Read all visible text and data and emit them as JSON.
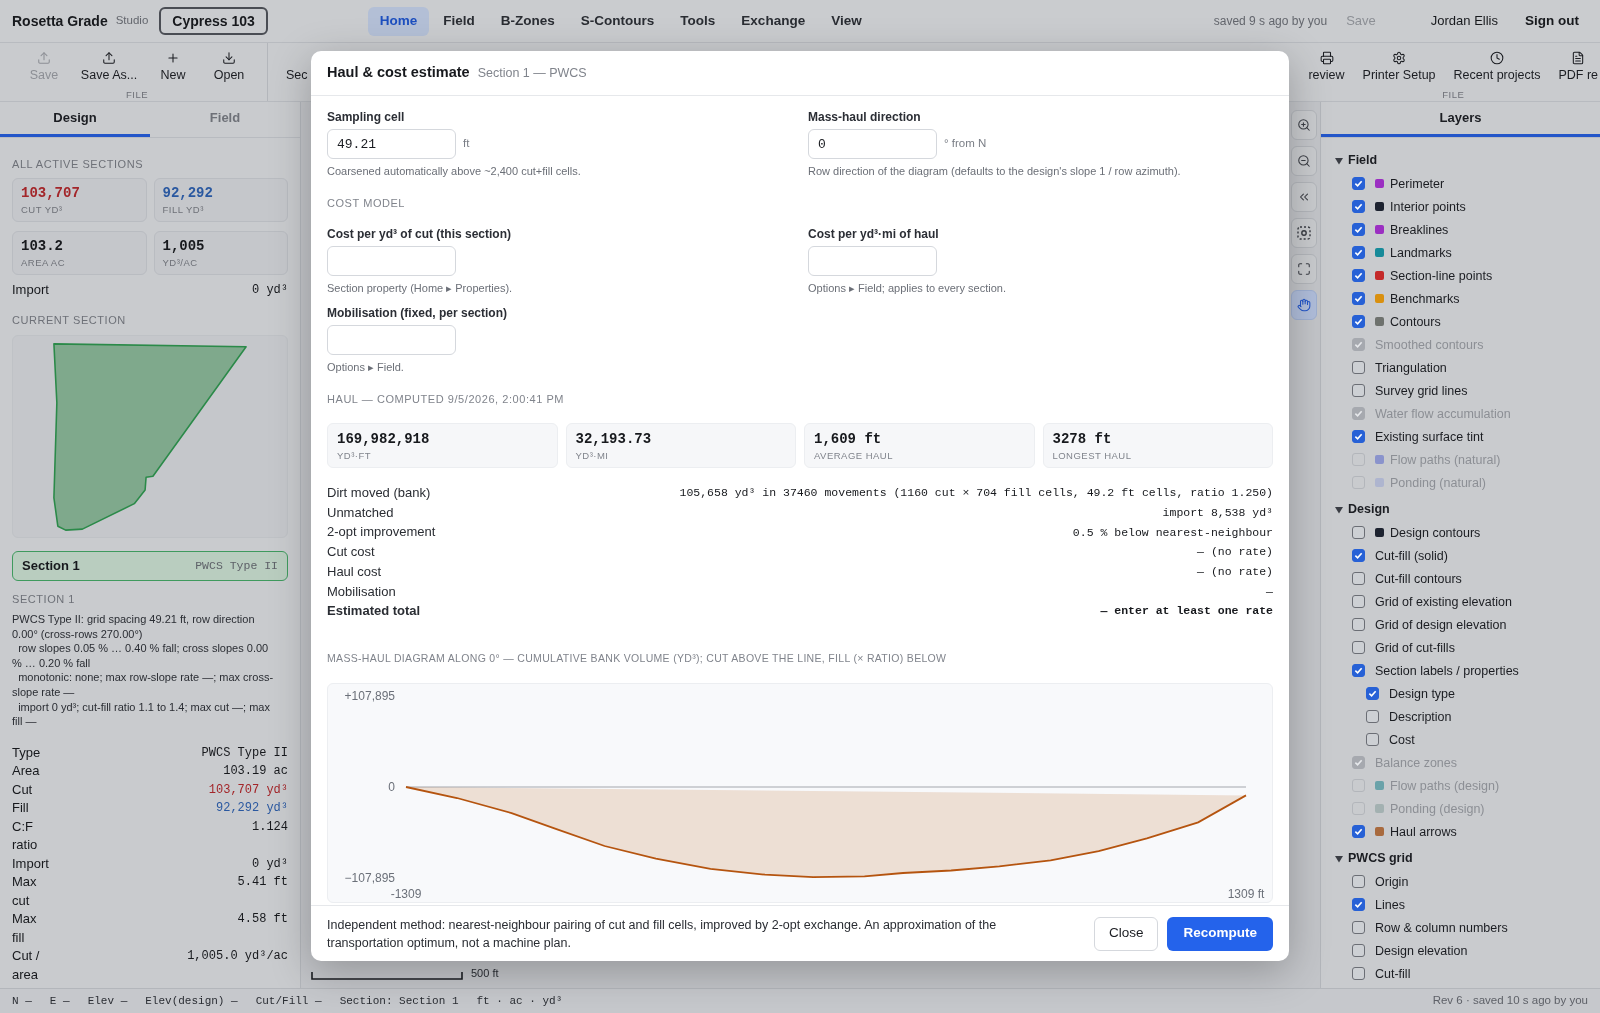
{
  "header": {
    "app_name": "Rosetta Grade",
    "edition": "Studio",
    "project": "Cypress 103",
    "nav": [
      {
        "label": "Home",
        "selected": true
      },
      {
        "label": "Field",
        "selected": false
      },
      {
        "label": "B-Zones",
        "selected": false
      },
      {
        "label": "S-Contours",
        "selected": false
      },
      {
        "label": "Tools",
        "selected": false
      },
      {
        "label": "Exchange",
        "selected": false
      },
      {
        "label": "View",
        "selected": false
      }
    ],
    "save_status": "saved 9 s ago by you",
    "save": {
      "label": "Save",
      "disabled": true
    },
    "user": "Jordan Ellis",
    "sign_out": "Sign out"
  },
  "toolbar": {
    "left_group": {
      "label": "FILE",
      "items": [
        {
          "kind": "save",
          "label": "Save",
          "disabled": true
        },
        {
          "kind": "save-as",
          "label": "Save As...",
          "disabled": false
        },
        {
          "kind": "new",
          "label": "New",
          "disabled": false
        },
        {
          "kind": "open",
          "label": "Open",
          "disabled": false
        }
      ]
    },
    "section_item": {
      "label": "Sec"
    },
    "right_group": {
      "label": "FILE",
      "items": [
        {
          "kind": "preview",
          "label": "review"
        },
        {
          "kind": "printer-setup",
          "label": "Printer Setup"
        },
        {
          "kind": "recent",
          "label": "Recent projects"
        },
        {
          "kind": "pdf",
          "label": "PDF re"
        }
      ]
    }
  },
  "left_panel": {
    "tabs": [
      {
        "label": "Design",
        "selected": true
      },
      {
        "label": "Field",
        "selected": false
      }
    ],
    "totals_heading": "ALL ACTIVE SECTIONS",
    "totals": [
      {
        "value": "103,707",
        "label": "CUT YD³",
        "kind": "cut"
      },
      {
        "value": "92,292",
        "label": "FILL YD³",
        "kind": "fill"
      },
      {
        "value": "103.2",
        "label": "AREA AC",
        "kind": "plain"
      },
      {
        "value": "1,005",
        "label": "YD³/AC",
        "kind": "plain"
      }
    ],
    "import": {
      "label": "Import",
      "value": "0 yd³"
    },
    "current_heading": "CURRENT SECTION",
    "sections": [
      {
        "name": "Section 1",
        "type": "PWCS Type II",
        "selected": true
      }
    ],
    "detail_heading": "SECTION 1",
    "description": "PWCS Type II: grid spacing 49.21 ft, row direction 0.00° (cross-rows 270.00°)\n  row slopes 0.05 % … 0.40 % fall; cross slopes 0.00 % … 0.20 % fall\n  monotonic: none; max row-slope rate —; max cross-slope rate —\n  import 0 yd³; cut-fill ratio 1.1 to 1.4; max cut —; max fill —",
    "properties": [
      {
        "label": "Type",
        "value": "PWCS Type II",
        "kind": "plain"
      },
      {
        "label": "Area",
        "value": "103.19 ac",
        "kind": "plain"
      },
      {
        "label": "Cut",
        "value": "103,707 yd³",
        "kind": "cut"
      },
      {
        "label": "Fill",
        "value": "92,292 yd³",
        "kind": "fill"
      },
      {
        "label": "C:F ratio",
        "value": "1.124",
        "kind": "plain"
      },
      {
        "label": "Import",
        "value": "0 yd³",
        "kind": "plain"
      },
      {
        "label": "Max cut",
        "value": "5.41 ft",
        "kind": "plain"
      },
      {
        "label": "Max fill",
        "value": "4.58 ft",
        "kind": "plain"
      },
      {
        "label": "Cut / area",
        "value": "1,005.0 yd³/ac",
        "kind": "plain"
      }
    ]
  },
  "canvas": {
    "tools": [
      {
        "kind": "zoom-in",
        "active": false
      },
      {
        "kind": "zoom-out",
        "active": false
      },
      {
        "kind": "collapse",
        "active": false
      },
      {
        "kind": "select",
        "active": false
      },
      {
        "kind": "fit",
        "active": false
      },
      {
        "kind": "pan",
        "active": true
      }
    ],
    "scale_label": "500 ft"
  },
  "layers": {
    "tab": {
      "label": "Layers",
      "selected": true
    },
    "groups": [
      {
        "label": "Field",
        "expanded": true,
        "items": [
          {
            "label": "Perimeter",
            "checked": true,
            "disabled": false,
            "color": "#9b2fc2"
          },
          {
            "label": "Interior points",
            "checked": true,
            "disabled": false,
            "color": "#1d2330"
          },
          {
            "label": "Breaklines",
            "checked": true,
            "disabled": false,
            "color": "#9b2fc2"
          },
          {
            "label": "Landmarks",
            "checked": true,
            "disabled": false,
            "color": "#168a99"
          },
          {
            "label": "Section-line points",
            "checked": true,
            "disabled": false,
            "color": "#c42a2a"
          },
          {
            "label": "Benchmarks",
            "checked": true,
            "disabled": false,
            "color": "#d9900f"
          },
          {
            "label": "Contours",
            "checked": true,
            "disabled": false,
            "color": "#6e726e"
          },
          {
            "label": "Smoothed contours",
            "checked": true,
            "disabled": true
          },
          {
            "label": "Triangulation",
            "checked": false,
            "disabled": false
          },
          {
            "label": "Survey grid lines",
            "checked": false,
            "disabled": false
          },
          {
            "label": "Water flow accumulation",
            "checked": true,
            "disabled": true
          },
          {
            "label": "Existing surface tint",
            "checked": true,
            "disabled": false
          },
          {
            "label": "Flow paths (natural)",
            "checked": false,
            "disabled": true,
            "color": "#8a93cc"
          },
          {
            "label": "Ponding (natural)",
            "checked": false,
            "disabled": true,
            "color": "#aeb5cf"
          }
        ]
      },
      {
        "label": "Design",
        "expanded": true,
        "items": [
          {
            "label": "Design contours",
            "checked": false,
            "disabled": false,
            "color": "#1d2330"
          },
          {
            "label": "Cut-fill (solid)",
            "checked": true,
            "disabled": false
          },
          {
            "label": "Cut-fill contours",
            "checked": false,
            "disabled": false
          },
          {
            "label": "Grid of existing elevation",
            "checked": false,
            "disabled": false
          },
          {
            "label": "Grid of design elevation",
            "checked": false,
            "disabled": false
          },
          {
            "label": "Grid of cut-fills",
            "checked": false,
            "disabled": false
          },
          {
            "label": "Section labels / properties",
            "checked": true,
            "disabled": false,
            "children": [
              {
                "label": "Design type",
                "checked": true,
                "disabled": false
              },
              {
                "label": "Description",
                "checked": false,
                "disabled": false
              },
              {
                "label": "Cost",
                "checked": false,
                "disabled": false
              }
            ]
          },
          {
            "label": "Balance zones",
            "checked": true,
            "disabled": true
          },
          {
            "label": "Flow paths (design)",
            "checked": false,
            "disabled": true,
            "color": "#6aa2a9"
          },
          {
            "label": "Ponding (design)",
            "checked": false,
            "disabled": true,
            "color": "#a3b1b1"
          },
          {
            "label": "Haul arrows",
            "checked": true,
            "disabled": false,
            "color": "#a86a3e"
          }
        ]
      },
      {
        "label": "PWCS grid",
        "expanded": true,
        "items": [
          {
            "label": "Origin",
            "checked": false,
            "disabled": false
          },
          {
            "label": "Lines",
            "checked": true,
            "disabled": false
          },
          {
            "label": "Row & column numbers",
            "checked": false,
            "disabled": false
          },
          {
            "label": "Design elevation",
            "checked": false,
            "disabled": false
          },
          {
            "label": "Cut-fill",
            "checked": false,
            "disabled": false
          }
        ]
      }
    ]
  },
  "status_bar": {
    "readouts": [
      "N —",
      "E —",
      "Elev —",
      "Elev(design) —",
      "Cut/Fill —",
      "Section: Section 1",
      "ft · ac · yd³"
    ],
    "revision": "Rev 6 · saved 10 s ago by you"
  },
  "dialog": {
    "title": "Haul & cost estimate",
    "subtitle": "Section 1 — PWCS",
    "fields": [
      {
        "label": "Sampling cell",
        "value": "49.21",
        "unit": "ft",
        "hint": "Coarsened automatically above ~2,400 cut+fill cells."
      },
      {
        "label": "Mass-haul direction",
        "value": "0",
        "unit": "° from N",
        "hint": "Row direction of the diagram (defaults to the design's slope 1 / row azimuth)."
      }
    ],
    "cost_heading": "COST MODEL",
    "cost_fields": [
      {
        "label": "Cost per yd³ of cut (this section)",
        "hint": "Section property (Home ▸ Properties)."
      },
      {
        "label": "Cost per yd³·mi of haul",
        "hint": "Options ▸ Field; applies to every section."
      },
      {
        "label": "Mobilisation (fixed, per section)",
        "hint": "Options ▸ Field."
      }
    ],
    "haul_heading": "HAUL — COMPUTED 9/5/2026, 2:00:41 PM",
    "haul_stats": [
      {
        "value": "169,982,918",
        "label": "YD³·FT"
      },
      {
        "value": "32,193.73",
        "label": "YD³·MI"
      },
      {
        "value": "1,609 ft",
        "label": "AVERAGE HAUL"
      },
      {
        "value": "3278 ft",
        "label": "LONGEST HAUL"
      }
    ],
    "results": [
      {
        "label": "Dirt moved (bank)",
        "value": "105,658 yd³ in 37460 movements (1160 cut × 704 fill cells, 49.2 ft cells, ratio 1.250)",
        "emphasis": false
      },
      {
        "label": "Unmatched",
        "value": "import 8,538 yd³",
        "emphasis": false
      },
      {
        "label": "2-opt improvement",
        "value": "0.5 % below nearest-neighbour",
        "emphasis": false
      },
      {
        "label": "Cut cost",
        "value": "— (no rate)",
        "emphasis": false
      },
      {
        "label": "Haul cost",
        "value": "— (no rate)",
        "emphasis": false
      },
      {
        "label": "Mobilisation",
        "value": "—",
        "emphasis": false
      },
      {
        "label": "Estimated total",
        "value": "— enter at least one rate",
        "emphasis": true
      }
    ],
    "mass_haul": {
      "chart_data": {
        "type": "area",
        "title": "MASS-HAUL DIAGRAM ALONG 0° — CUMULATIVE BANK VOLUME (YD³); CUT ABOVE THE LINE, FILL (× RATIO) BELOW",
        "x": [
          -1309,
          -1150,
          -980,
          -840,
          -690,
          -530,
          -360,
          -190,
          -40,
          120,
          240,
          390,
          540,
          700,
          850,
          1000,
          1160,
          1309
        ],
        "series": [
          {
            "color": "#b5540f",
            "values": [
              0,
              -13000,
              -31000,
              -50000,
              -70000,
              -85000,
              -97000,
              -104000,
              -107000,
              -106000,
              -102000,
              -99000,
              -94000,
              -87000,
              -76000,
              -61000,
              -42000,
              -10000
            ]
          }
        ],
        "xlim": [
          -1309,
          1309
        ],
        "ylim": [
          -107895,
          107895
        ],
        "xticks": [
          {
            "value": -1309,
            "label": "-1309"
          },
          {
            "value": 1309,
            "label": "1309 ft"
          }
        ],
        "yticks": [
          {
            "value": 107895,
            "label": "+107,895"
          },
          {
            "value": 0,
            "label": "0"
          },
          {
            "value": -107895,
            "label": "−107,895"
          }
        ]
      }
    },
    "note": "Independent method: nearest-neighbour pairing of cut and fill cells, improved by 2-opt exchange. An approximation of the transportation optimum, not a machine plan.",
    "buttons": [
      {
        "label": "Close",
        "kind": "secondary"
      },
      {
        "label": "Recompute",
        "kind": "primary"
      }
    ]
  }
}
